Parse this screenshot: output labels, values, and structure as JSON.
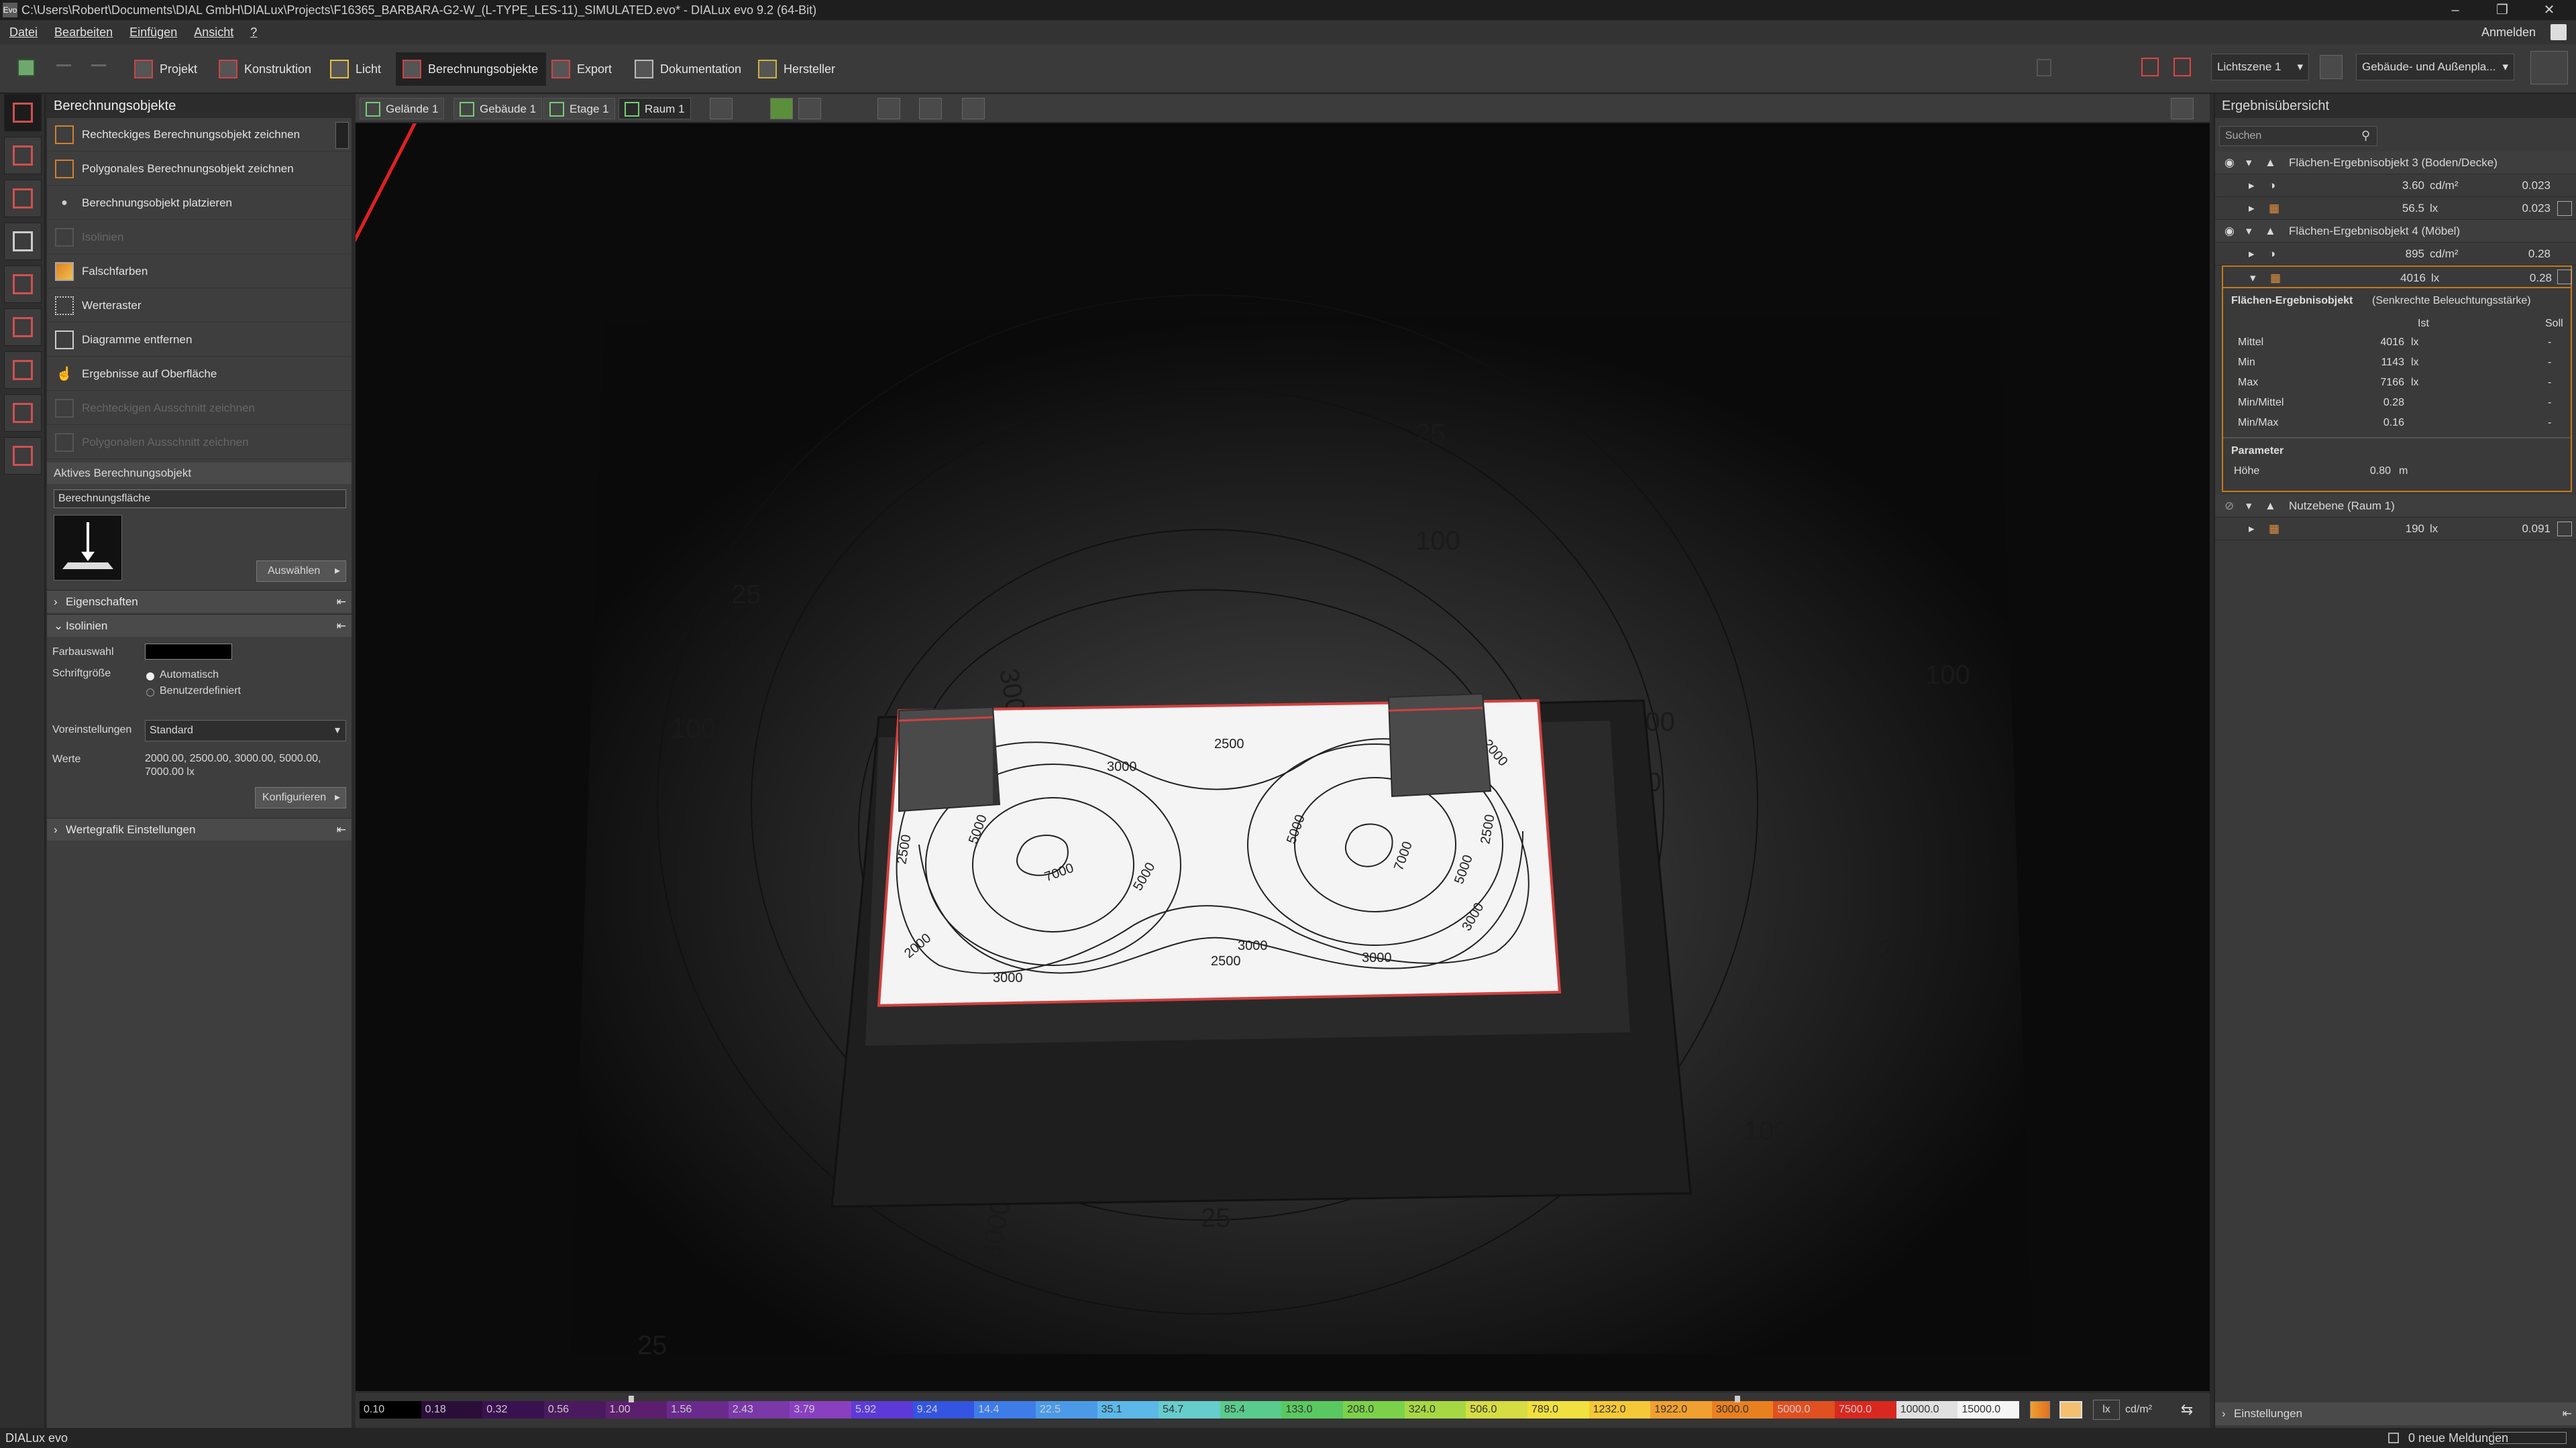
{
  "window": {
    "title": "C:\\Users\\Robert\\Documents\\DIAL GmbH\\DIALux\\Projects\\F16365_BARBARA-G2-W_(L-TYPE_LES-11)_SIMULATED.evo* - DIALux evo 9.2  (64-Bit)",
    "app_icon": "Evo"
  },
  "menu": {
    "items": [
      "Datei",
      "Bearbeiten",
      "Einfügen",
      "Ansicht",
      "?"
    ],
    "signin": "Anmelden"
  },
  "toolbar": {
    "modes": [
      "Projekt",
      "Konstruktion",
      "Licht",
      "Berechnungsobjekte",
      "Export",
      "Dokumentation",
      "Hersteller"
    ],
    "active_mode": "Berechnungsobjekte",
    "lightscene": "Lichtszene 1",
    "view_select": "Gebäude- und Außenpla..."
  },
  "left_panel": {
    "header": "Berechnungsobjekte",
    "tools": [
      {
        "label": "Rechteckiges Berechnungsobjekt zeichnen",
        "enabled": true
      },
      {
        "label": "Polygonales Berechnungsobjekt zeichnen",
        "enabled": true
      },
      {
        "label": "Berechnungsobjekt platzieren",
        "enabled": true
      },
      {
        "label": "Isolinien",
        "enabled": false
      },
      {
        "label": "Falschfarben",
        "enabled": true
      },
      {
        "label": "Werteraster",
        "enabled": true
      },
      {
        "label": "Diagramme entfernen",
        "enabled": true
      },
      {
        "label": "Ergebnisse auf Oberfläche",
        "enabled": true
      },
      {
        "label": "Rechteckigen Ausschnitt zeichnen",
        "enabled": false
      },
      {
        "label": "Polygonalen Ausschnitt zeichnen",
        "enabled": false
      }
    ],
    "active_section": "Aktives Berechnungsobjekt",
    "active_object_name": "Berechnungsfläche",
    "select_button": "Auswählen",
    "sections": {
      "properties": "Eigenschaften",
      "isolines": "Isolinien",
      "valuegraph": "Wertegrafik Einstellungen"
    },
    "isolines": {
      "color_label": "Farbauswahl",
      "fontsize_label": "Schriftgröße",
      "font_auto": "Automatisch",
      "font_custom": "Benutzerdefiniert",
      "presets_label": "Voreinstellungen",
      "preset_value": "Standard",
      "values_label": "Werte",
      "values_text": "2000.00, 2500.00, 3000.00, 5000.00, 7000.00 lx",
      "configure_button": "Konfigurieren"
    }
  },
  "viewport": {
    "breadcrumb": [
      "Gelände 1",
      "Gebäude 1",
      "Etage 1",
      "Raum 1"
    ],
    "isoline_labels": [
      "2500",
      "3000",
      "3000",
      "5000",
      "5000",
      "5000",
      "5000",
      "7000",
      "7000",
      "2500",
      "2500",
      "2000",
      "2000",
      "3000",
      "3000",
      "2500",
      "3000"
    ],
    "outer_labels": [
      "25",
      "100",
      "25",
      "100",
      "3000",
      "500",
      "25",
      "100",
      "25",
      "3000",
      "25",
      "100",
      "500",
      "25"
    ]
  },
  "colorbar": {
    "values": [
      "0.10",
      "0.18",
      "0.32",
      "0.56",
      "1.00",
      "1.56",
      "2.43",
      "3.79",
      "5.92",
      "9.24",
      "14.4",
      "22.5",
      "35.1",
      "54.7",
      "85.4",
      "133.0",
      "208.0",
      "324.0",
      "506.0",
      "789.0",
      "1232.0",
      "1922.0",
      "3000.0",
      "5000.0",
      "7500.0",
      "10000.0",
      "15000.0"
    ],
    "colors": [
      "#000000",
      "#2b0d3a",
      "#3a1150",
      "#4b1a5e",
      "#5c1f6e",
      "#6a2a8c",
      "#7b38a8",
      "#8940c0",
      "#5d3ad8",
      "#3355e0",
      "#3e7ce8",
      "#4b9ae8",
      "#5cb8e8",
      "#66cccc",
      "#5acb8c",
      "#5ac860",
      "#7bd14a",
      "#a6d844",
      "#d6dc44",
      "#f0e040",
      "#f4c838",
      "#f0a030",
      "#e88020",
      "#e05020",
      "#d82820",
      "#e0e0e0",
      "#f4f4f4"
    ],
    "unit_lx": "lx",
    "unit_cd": "cd/m²"
  },
  "right_panel": {
    "header": "Ergebnisübersicht",
    "search_placeholder": "Suchen",
    "objects": [
      {
        "name": "Flächen-Ergebnisobjekt 3 (Boden/Decke)",
        "rows": [
          {
            "value": "3.60",
            "unit": "cd/m²",
            "ratio": "0.023"
          },
          {
            "value": "56.5",
            "unit": "lx",
            "ratio": "0.023"
          }
        ]
      },
      {
        "name": "Flächen-Ergebnisobjekt 4 (Möbel)",
        "rows": [
          {
            "value": "895",
            "unit": "cd/m²",
            "ratio": "0.28"
          },
          {
            "value": "4016",
            "unit": "lx",
            "ratio": "0.28"
          }
        ]
      },
      {
        "name": "Nutzebene (Raum 1)",
        "rows": [
          {
            "value": "190",
            "unit": "lx",
            "ratio": "0.091"
          }
        ]
      }
    ],
    "detail": {
      "title": "Flächen-Ergebnisobjekt",
      "subtitle": "(Senkrechte Beleuchtungsstärke)",
      "col_ist": "Ist",
      "col_soll": "Soll",
      "rows": [
        {
          "label": "Mittel",
          "value": "4016",
          "unit": "lx",
          "soll": "-"
        },
        {
          "label": "Min",
          "value": "1143",
          "unit": "lx",
          "soll": "-"
        },
        {
          "label": "Max",
          "value": "7166",
          "unit": "lx",
          "soll": "-"
        },
        {
          "label": "Min/Mittel",
          "value": "0.28",
          "unit": "",
          "soll": "-"
        },
        {
          "label": "Min/Max",
          "value": "0.16",
          "unit": "",
          "soll": "-"
        }
      ],
      "param_title": "Parameter",
      "param_label": "Höhe",
      "param_value": "0.80",
      "param_unit": "m"
    },
    "settings": "Einstellungen"
  },
  "status": {
    "brand": "DIALux evo",
    "messages": "0 neue Meldungen"
  }
}
